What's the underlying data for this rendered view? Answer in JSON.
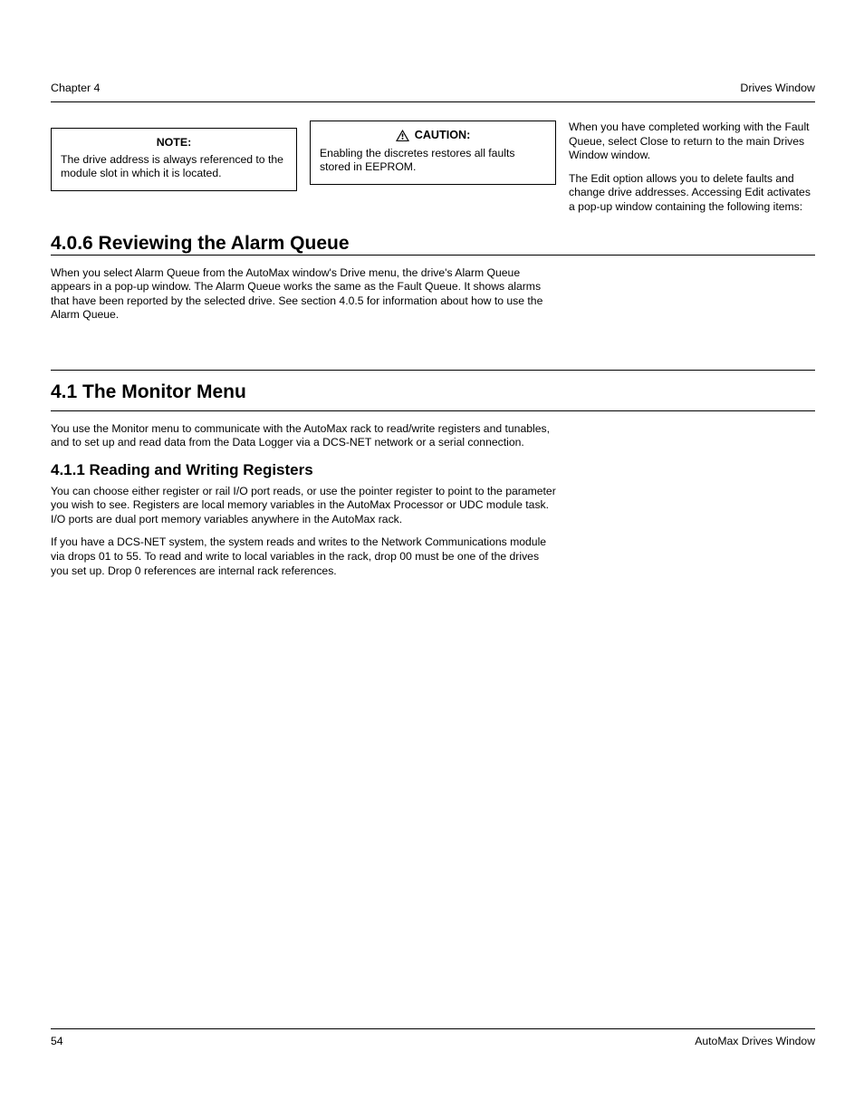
{
  "header": {
    "left": "Chapter 4",
    "right": "Drives Window"
  },
  "col1": {
    "note_label": "NOTE:",
    "note_text": "The drive address is always referenced to the module slot in which it is located."
  },
  "col2": {
    "caution_label": "CAUTION:",
    "caution_text": "Enabling the discretes restores all faults stored in EEPROM."
  },
  "col3": {
    "p1": "When you have completed working with the Fault Queue, select Close to return to the main Drives Window window.",
    "p2": "The Edit option allows you to delete faults and change drive addresses. Accessing Edit activates a pop-up window containing the following items:"
  },
  "section406": {
    "title": "4.0.6 Reviewing the Alarm Queue",
    "desc": "When you select Alarm Queue from the AutoMax window's Drive menu, the drive's Alarm Queue appears in a pop-up window. The Alarm Queue works the same as the Fault Queue. It shows alarms that have been reported by the selected drive. See section 4.0.5 for information about how to use the Alarm Queue."
  },
  "section41": {
    "title": "4.1 The Monitor Menu",
    "desc": "You use the Monitor menu to communicate with the AutoMax rack to read/write registers and tunables, and to set up and read data from the Data Logger via a DCS-NET network or a serial connection."
  },
  "section411": {
    "title": "4.1.1 Reading and Writing Registers",
    "para1": "You can choose either register or rail I/O port reads, or use the pointer register to point to the parameter you wish to see. Registers are local memory variables in the AutoMax Processor or UDC module task. I/O ports are dual port memory variables anywhere in the AutoMax rack.",
    "para2": "If you have a DCS-NET system, the system reads and writes to the Network Communications module via drops 01 to 55. To read and write to local variables in the rack, drop 00 must be one of the drives you set up. Drop 0 references are internal rack references."
  },
  "footer": {
    "left": "54",
    "right": "AutoMax Drives Window"
  }
}
